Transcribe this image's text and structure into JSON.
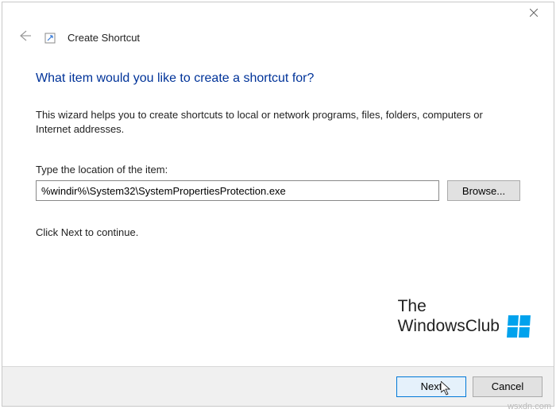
{
  "header": {
    "title": "Create Shortcut"
  },
  "main": {
    "heading": "What item would you like to create a shortcut for?",
    "description": "This wizard helps you to create shortcuts to local or network programs, files, folders, computers or Internet addresses.",
    "location_label": "Type the location of the item:",
    "location_value": "%windir%\\System32\\SystemPropertiesProtection.exe",
    "browse_label": "Browse...",
    "continue_text": "Click Next to continue."
  },
  "footer": {
    "next_label": "Next",
    "cancel_label": "Cancel"
  },
  "watermark": {
    "line1": "The",
    "line2": "WindowsClub",
    "site": "wsxdn.com"
  }
}
